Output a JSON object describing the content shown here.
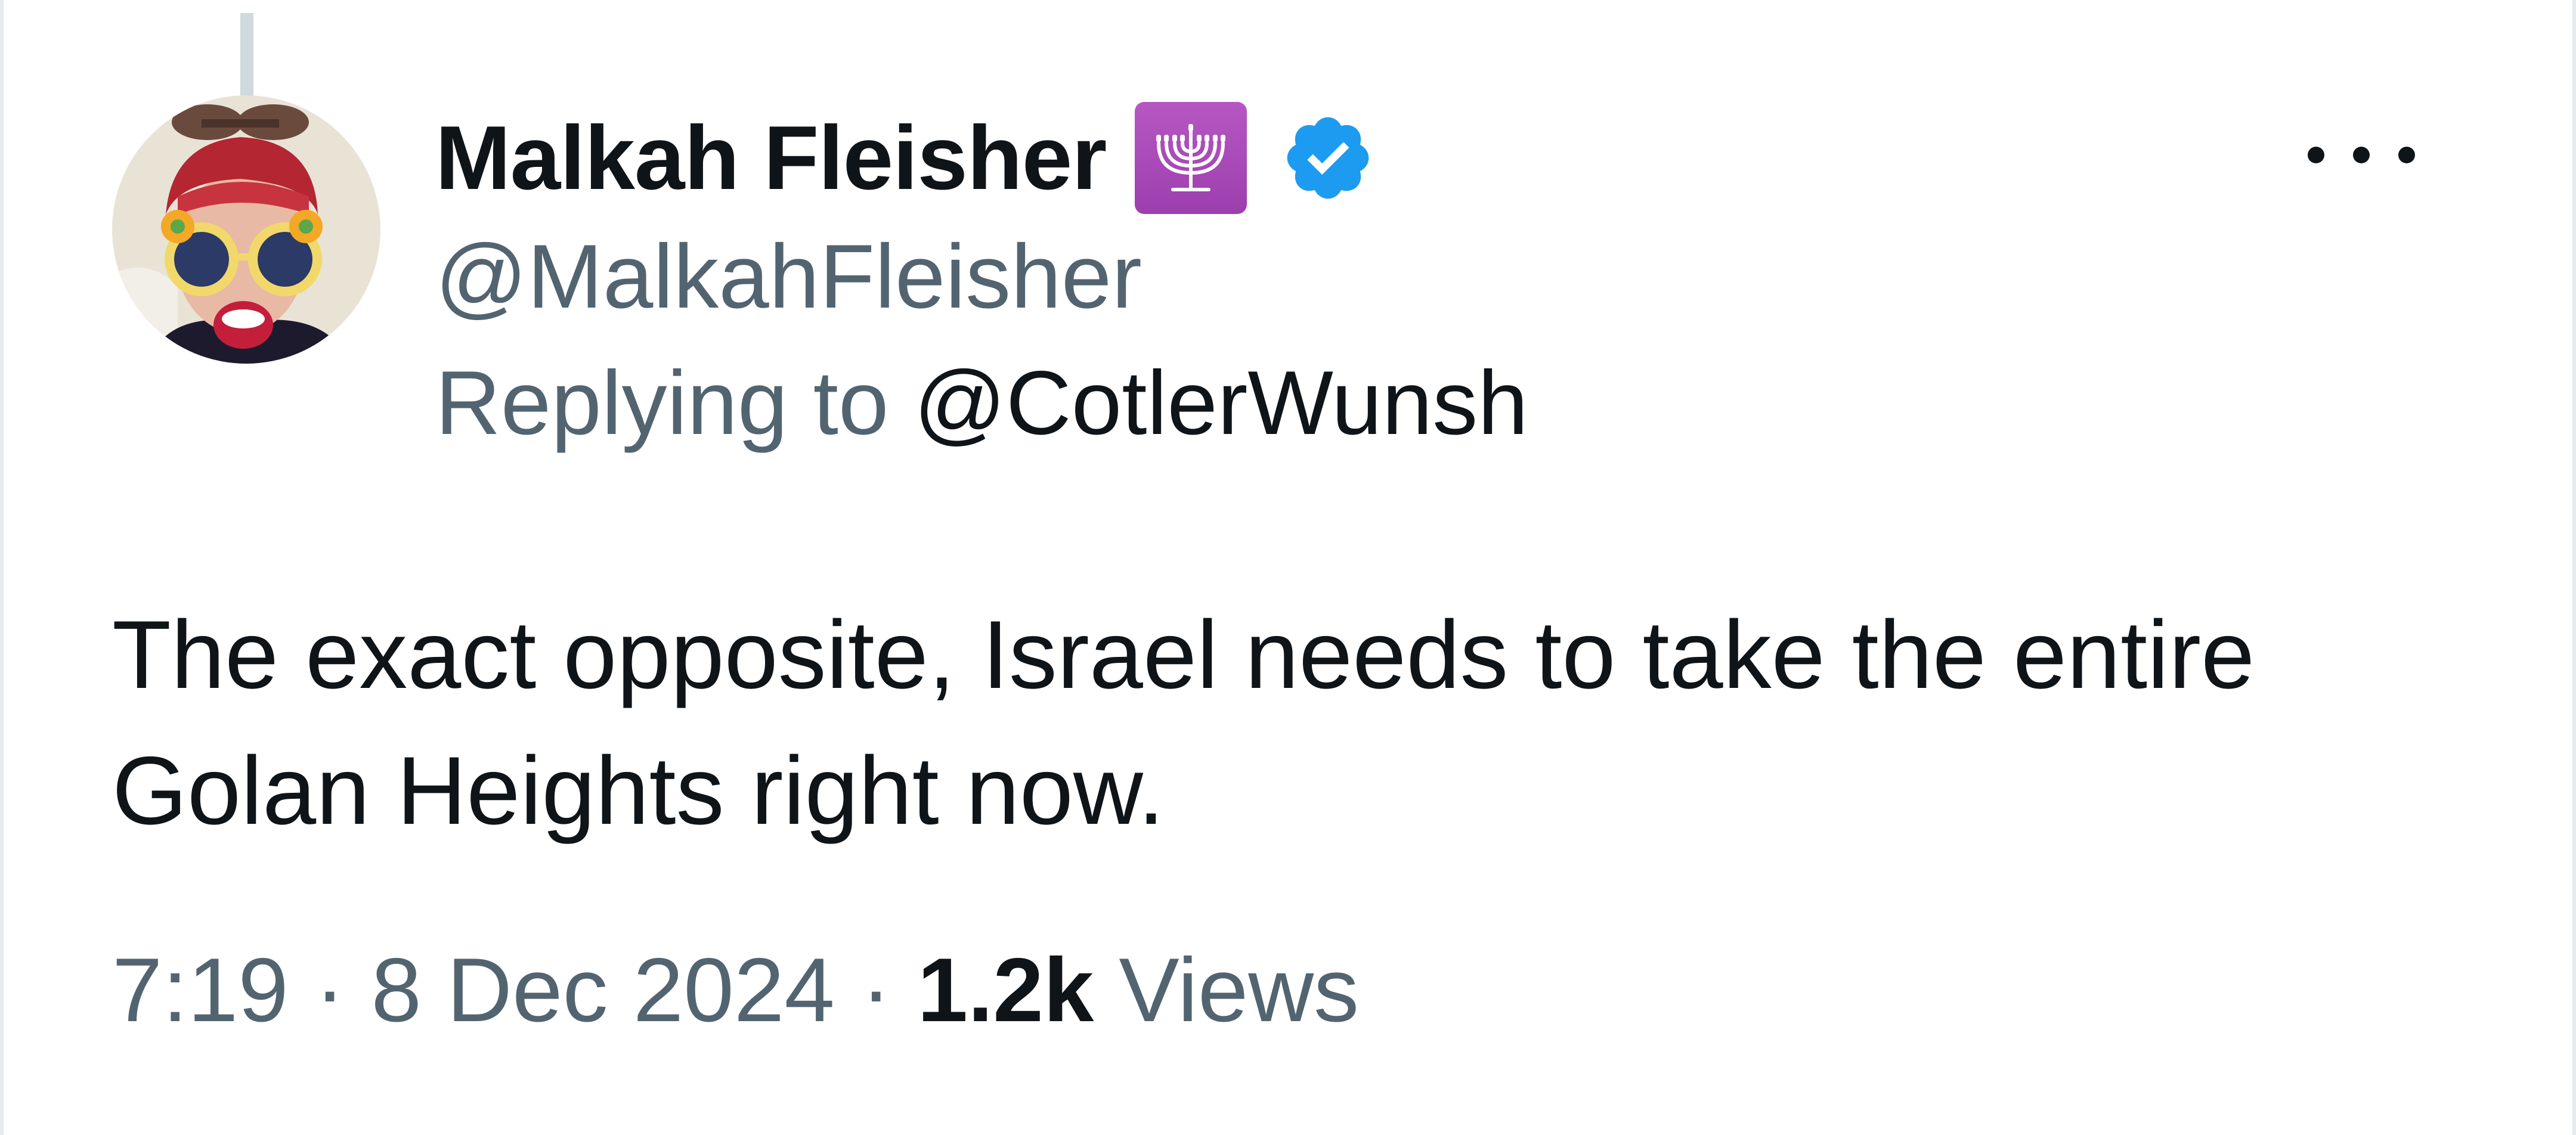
{
  "tweet": {
    "author": {
      "display_name": "Malkah Fleisher",
      "handle": "@MalkahFleisher",
      "emoji_icon": "menorah-icon",
      "verified": true,
      "verified_color": "#1d9bf0"
    },
    "reply": {
      "prefix": "Replying to",
      "target": "@CotlerWunsh"
    },
    "text_lines": [
      "The exact opposite, Israel needs to take the entire",
      "Golan Heights right now."
    ],
    "meta": {
      "time": "7:19",
      "separator": "·",
      "date": "8 Dec 2024",
      "views_count": "1.2k",
      "views_label": "Views"
    },
    "more_icon": "more-horizontal-icon"
  },
  "colors": {
    "primary_text": "#0f1419",
    "secondary_text": "#536471",
    "thread_line": "#cfd9de",
    "menorah_bg": "#a94ab9"
  }
}
